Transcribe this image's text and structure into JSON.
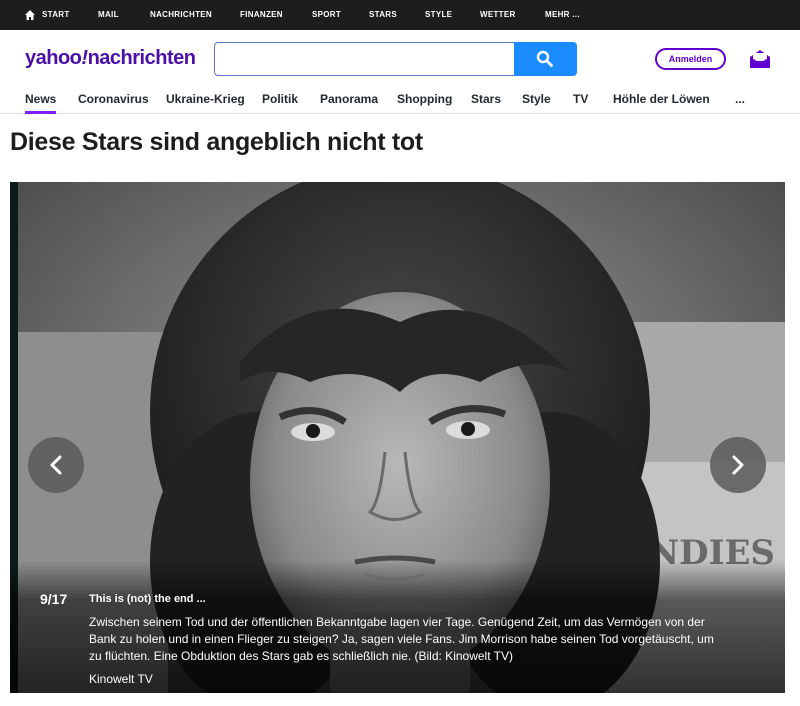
{
  "topbar": {
    "items": [
      "START",
      "MAIL",
      "NACHRICHTEN",
      "FINANZEN",
      "SPORT",
      "STARS",
      "STYLE",
      "WETTER",
      "MEHR ..."
    ]
  },
  "header": {
    "logo_main": "yahoo",
    "logo_excl": "!",
    "logo_sub": "nachrichten",
    "search_placeholder": "",
    "signin_label": "Anmelden",
    "brand_color": "#6001d2"
  },
  "nav": {
    "items": [
      "News",
      "Coronavirus",
      "Ukraine-Krieg",
      "Politik",
      "Panorama",
      "Shopping",
      "Stars",
      "Style",
      "TV",
      "Höhle der Löwen",
      "..."
    ],
    "active": "News"
  },
  "page": {
    "title": "Diese Stars sind angeblich nicht tot"
  },
  "slide": {
    "counter": "9/17",
    "title": "This is (not) the end ...",
    "text": "Zwischen seinem Tod und der öffentlichen Bekanntgabe lagen vier Tage. Genügend Zeit, um das Vermögen von der Bank zu holen und in einen Flieger zu steigen? Ja, sagen viele Fans. Jim Morrison habe seinen Tod vorgetäuscht, um zu flüchten. Eine Obduktion des Stars gab es schließlich nie. (Bild: Kinowelt TV)",
    "credit": "Kinowelt TV",
    "sign_text": "NDIES"
  }
}
